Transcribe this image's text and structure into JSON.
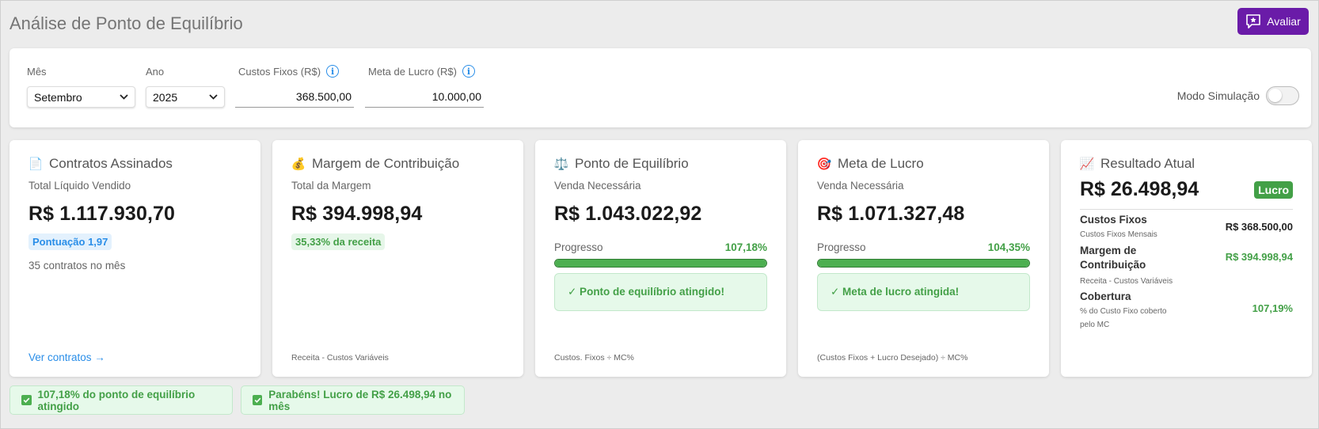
{
  "header": {
    "title": "Análise de Ponto de Equilíbrio",
    "rate_button": "Avaliar",
    "accent": "#6a1ba8"
  },
  "filters": {
    "month_label": "Mês",
    "month_value": "Setembro",
    "year_label": "Ano",
    "year_value": "2025",
    "fixed_costs_label": "Custos Fixos (R$)",
    "fixed_costs_value": "368.500,00",
    "profit_goal_label": "Meta de Lucro (R$)",
    "profit_goal_value": "10.000,00",
    "simulation_label": "Modo Simulação",
    "simulation_on": false
  },
  "cards": {
    "contracts": {
      "icon": "📄",
      "title": "Contratos Assinados",
      "subtitle": "Total Líquido Vendido",
      "value": "R$ 1.117.930,70",
      "chip": "Pontuação 1,97",
      "note": "35 contratos no mês",
      "link": "Ver contratos →"
    },
    "margin": {
      "icon": "💰",
      "title": "Margem de Contribuição",
      "subtitle": "Total da Margem",
      "value": "R$ 394.998,94",
      "chip": "35,33% da receita",
      "footer": "Receita - Custos Variáveis"
    },
    "breakeven": {
      "icon": "⚖️",
      "title": "Ponto de Equilíbrio",
      "subtitle": "Venda Necessária",
      "value": "R$ 1.043.022,92",
      "progress_label": "Progresso",
      "progress_pct": "107,18%",
      "progress_fraction": 1.0,
      "alert": "✓ Ponto de equilíbrio atingido!",
      "footer": "Custos. Fixos ÷ MC%"
    },
    "profit_goal": {
      "icon": "🎯",
      "title": "Meta de Lucro",
      "subtitle": "Venda Necessária",
      "value": "R$ 1.071.327,48",
      "progress_label": "Progresso",
      "progress_pct": "104,35%",
      "progress_fraction": 1.0,
      "alert": "✓ Meta de lucro atingida!",
      "footer": "(Custos Fixos + Lucro Desejado) ÷ MC%"
    },
    "result": {
      "icon": "📈",
      "title": "Resultado Atual",
      "value": "R$ 26.498,94",
      "badge": "Lucro",
      "rows": [
        {
          "title": "Custos Fixos",
          "note": "Custos Fixos Mensais",
          "value": "R$ 368.500,00",
          "color": "#222222"
        },
        {
          "title": "Margem de Contribuição",
          "note": "Receita - Custos Variáveis",
          "value": "R$ 394.998,94",
          "color": "#43a047"
        },
        {
          "title": "Cobertura",
          "note": "% do Custo Fixo coberto pelo MC",
          "value": "107,19%",
          "color": "#43a047"
        }
      ]
    }
  },
  "notifications": [
    "107,18% do ponto de equilíbrio atingido",
    "Parabéns! Lucro de R$ 26.498,94 no mês"
  ]
}
